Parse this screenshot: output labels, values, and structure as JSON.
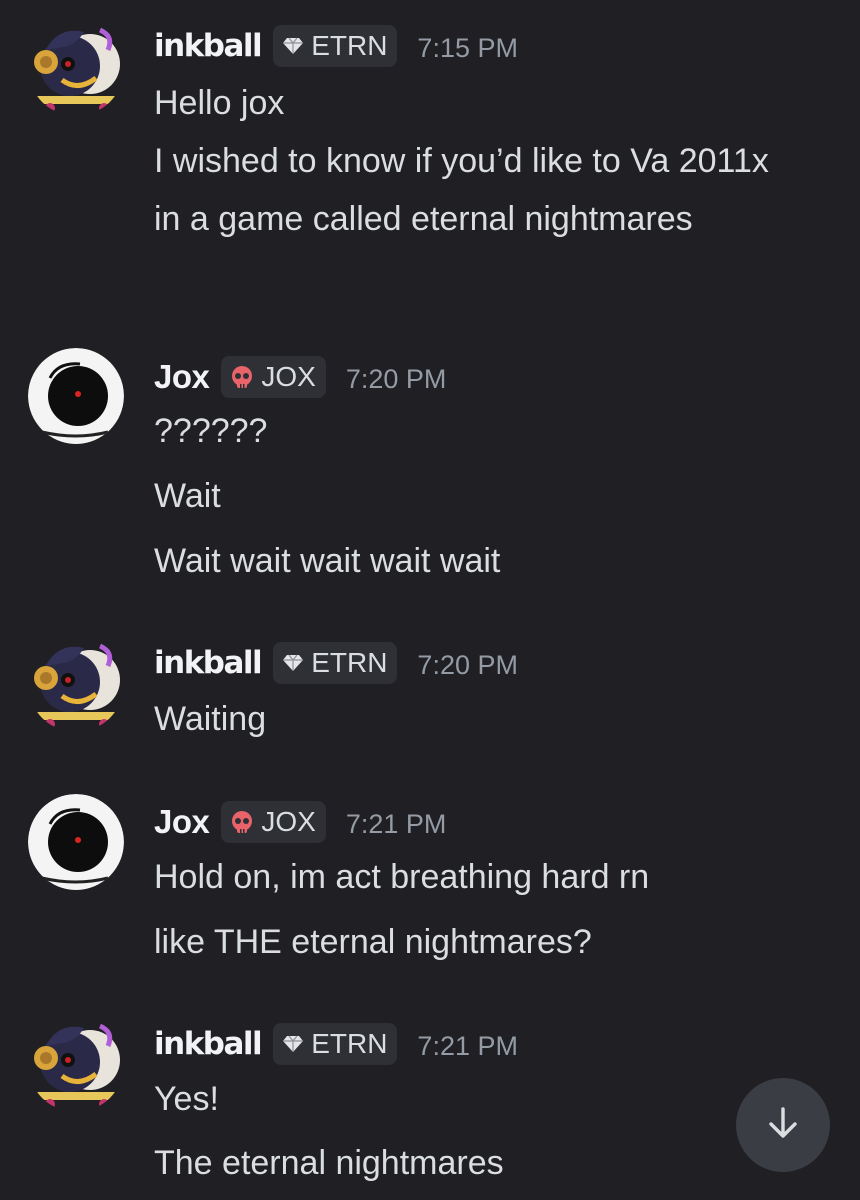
{
  "messages": [
    {
      "author": "inkball",
      "tag": "ETRN",
      "tag_icon": "gem-icon",
      "time": "7:15 PM",
      "lines": [
        "Hello jox",
        "I wished to know if you’d like to Va 2011x in a game called eternal nightmares"
      ]
    },
    {
      "author": "Jox",
      "tag": "JOX",
      "tag_icon": "skull-icon",
      "time": "7:20 PM",
      "lines": [
        "??????",
        "Wait",
        "Wait wait wait wait wait"
      ]
    },
    {
      "author": "inkball",
      "tag": "ETRN",
      "tag_icon": "gem-icon",
      "time": "7:20 PM",
      "lines": [
        "Waiting"
      ]
    },
    {
      "author": "Jox",
      "tag": "JOX",
      "tag_icon": "skull-icon",
      "time": "7:21 PM",
      "lines": [
        "Hold on, im act breathing hard rn",
        "like THE eternal nightmares?"
      ]
    },
    {
      "author": "inkball",
      "tag": "ETRN",
      "tag_icon": "gem-icon",
      "time": "7:21 PM",
      "lines": [
        "Yes!",
        "The eternal nightmares"
      ]
    }
  ],
  "scroll_button_icon": "arrow-down-icon",
  "colors": {
    "background": "#1f1f24",
    "text": "#dbdee1",
    "username": "#f2f3f5",
    "timestamp": "#949ba4",
    "tag_bg": "#2e3036",
    "skull": "#e8636a",
    "scroll_button_bg": "#3b3d44"
  }
}
